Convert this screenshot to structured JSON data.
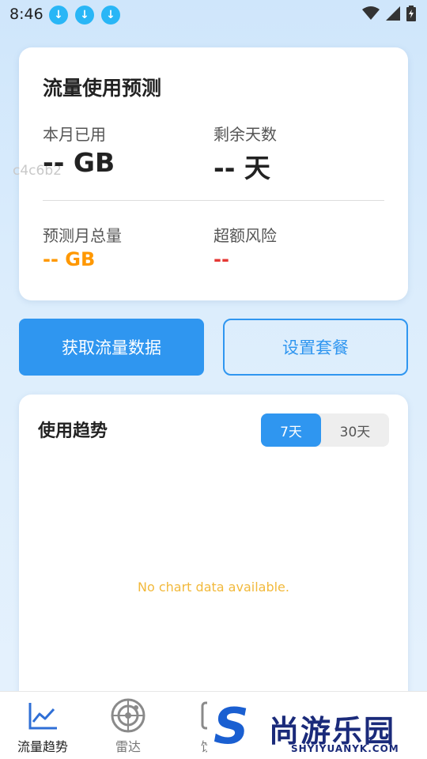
{
  "status_bar": {
    "time": "8:46"
  },
  "stats_card": {
    "title": "流量使用预测",
    "ghost_text": "c4c6b2",
    "used_label": "本月已用",
    "used_value": "-- GB",
    "remaining_days_label": "剩余天数",
    "remaining_days_value": "-- 天",
    "forecast_label": "预测月总量",
    "forecast_value": "-- GB",
    "risk_label": "超额风险",
    "risk_value": "--"
  },
  "actions": {
    "fetch_label": "获取流量数据",
    "plan_label": "设置套餐"
  },
  "trend_card": {
    "title": "使用趋势",
    "range_options": [
      "7天",
      "30天"
    ],
    "selected_range": "7天",
    "empty_message": "No chart data available."
  },
  "bottom_nav": {
    "items": [
      {
        "label": "流量趋势",
        "icon": "line-chart-icon",
        "active": true
      },
      {
        "label": "雷达",
        "icon": "radar-icon",
        "active": false
      },
      {
        "label": "饮食",
        "icon": "food-icon",
        "active": false
      }
    ]
  },
  "watermark": {
    "cn": "尚游乐园",
    "en": "SHYIYUANYK.COM"
  },
  "colors": {
    "primary": "#2f96f0",
    "warning": "#ff9800",
    "danger": "#e53935",
    "empty": "#f2b93b"
  }
}
